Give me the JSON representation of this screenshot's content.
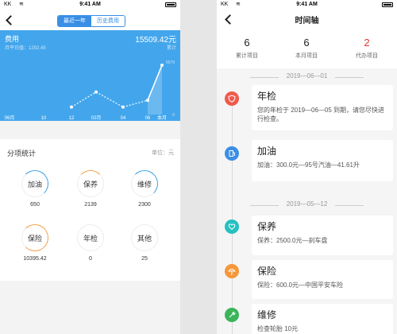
{
  "status_bar": {
    "carrier": "KK",
    "time": "9:41 AM"
  },
  "left": {
    "segments": [
      "最近一年",
      "历史费用"
    ],
    "selected_segment": "最近一年",
    "hero": {
      "title": "费用",
      "amount": "15509.42元",
      "avg_label": "月平均值：1292.45",
      "cum_label": "累计",
      "color": "#43a6ec"
    },
    "chart_data": {
      "type": "line",
      "categories": [
        "06月",
        "10",
        "12",
        "02月",
        "04",
        "06",
        "本月"
      ],
      "y_tick_top": "6579",
      "y_tick_bottom": "0",
      "points": [
        {
          "x": "12",
          "value": 1000
        },
        {
          "x": "02月",
          "value": 3000
        },
        {
          "x": "04",
          "value": 1000
        },
        {
          "x": "06",
          "value": 1900
        },
        {
          "x": "本月",
          "value": 6579
        }
      ]
    },
    "stats": {
      "title": "分项统计",
      "unit": "单位：元",
      "items": [
        {
          "name": "加油",
          "value": "650"
        },
        {
          "name": "保养",
          "value": "2139"
        },
        {
          "name": "维修",
          "value": "2300"
        },
        {
          "name": "保险",
          "value": "10395.42"
        },
        {
          "name": "年检",
          "value": "0"
        },
        {
          "name": "其他",
          "value": "25"
        }
      ]
    }
  },
  "right": {
    "title": "时间轴",
    "summary": [
      {
        "num": "6",
        "label": "累计项目"
      },
      {
        "num": "6",
        "label": "本月项目"
      },
      {
        "num": "2",
        "label": "代办项目"
      }
    ],
    "dates": [
      "2019—06—01",
      "2019—05—12"
    ],
    "events": [
      {
        "title": "年检",
        "desc": "您的年检于 2019—06—05 到期，请您尽快进行检查。",
        "color": "#ef5a4c",
        "icon": "shield-icon"
      },
      {
        "title": "加油",
        "desc": "加油：300.0元—95号汽油—41.61升",
        "color": "#3a8ee6",
        "icon": "fuel-icon"
      },
      {
        "title": "保养",
        "desc": "保养：2500.0元—刹车盘",
        "color": "#27c0c0",
        "icon": "heart-icon"
      },
      {
        "title": "保险",
        "desc": "保险：600.0元—中国平安车险",
        "color": "#f5983a",
        "icon": "umbrella-icon"
      },
      {
        "title": "维修",
        "desc": "检查轮胎 10元",
        "color": "#3cb45a",
        "icon": "wrench-icon"
      }
    ]
  }
}
